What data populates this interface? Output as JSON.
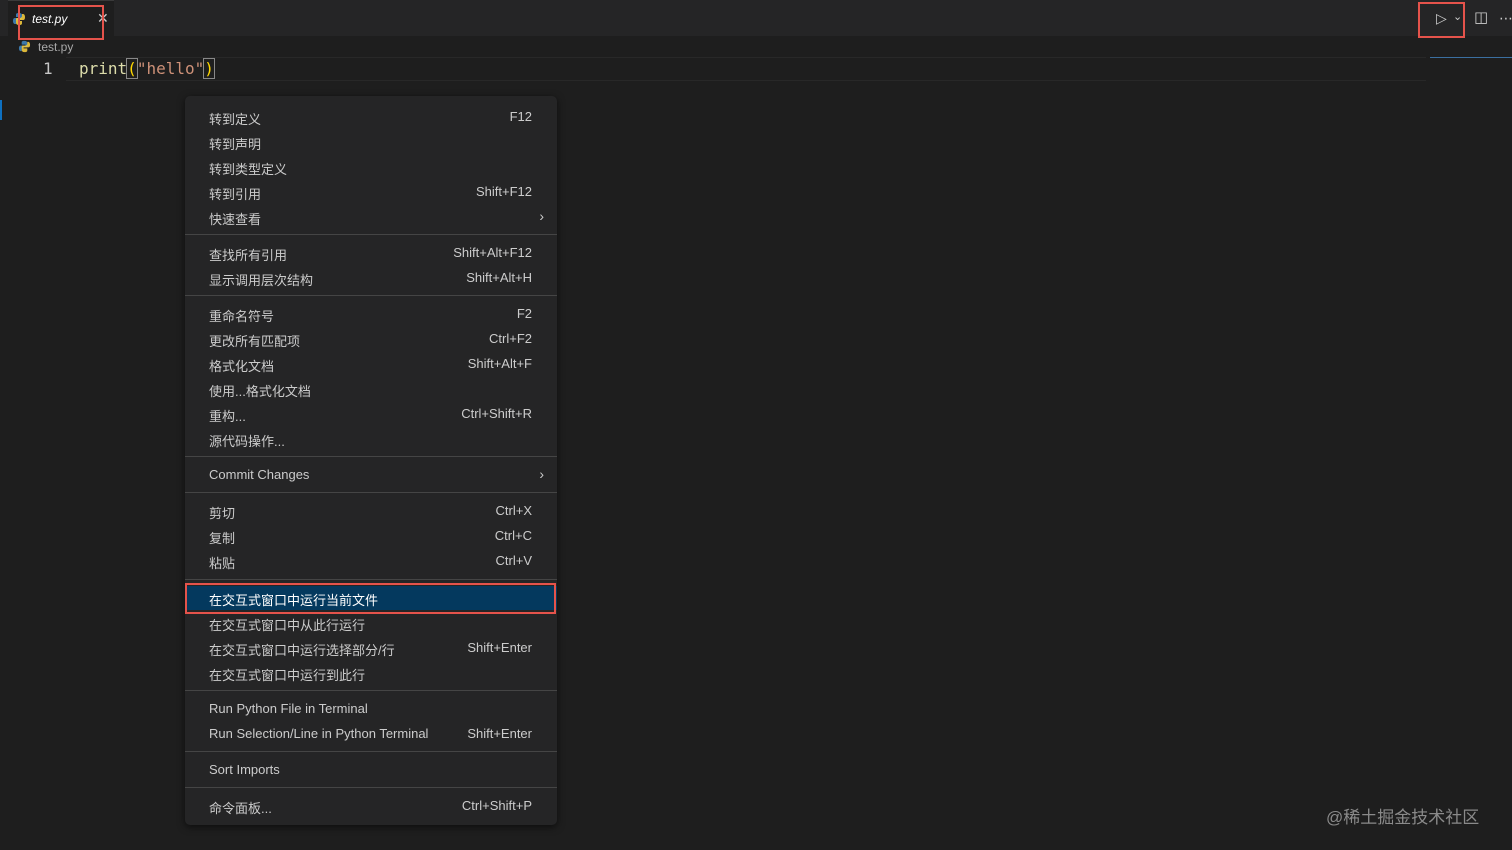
{
  "tab": {
    "filename": "test.py",
    "close_glyph": "✕"
  },
  "toolbar": {
    "run_icon": "▷",
    "run_dropdown_icon": "⌄",
    "split_icon": "◫",
    "more_icon": "⋯"
  },
  "breadcrumb": {
    "file": "test.py"
  },
  "editor": {
    "line_number": "1",
    "code": {
      "fn": "print",
      "open_paren": "(",
      "string": "\"hello\"",
      "close_paren": ")"
    }
  },
  "menu": {
    "items": [
      {
        "label": "转到定义",
        "key": "F12"
      },
      {
        "label": "转到声明",
        "key": ""
      },
      {
        "label": "转到类型定义",
        "key": ""
      },
      {
        "label": "转到引用",
        "key": "Shift+F12"
      },
      {
        "label": "快速查看",
        "key": "",
        "submenu": "›"
      },
      {
        "label": "查找所有引用",
        "key": "Shift+Alt+F12"
      },
      {
        "label": "显示调用层次结构",
        "key": "Shift+Alt+H"
      },
      {
        "label": "重命名符号",
        "key": "F2"
      },
      {
        "label": "更改所有匹配项",
        "key": "Ctrl+F2"
      },
      {
        "label": "格式化文档",
        "key": "Shift+Alt+F"
      },
      {
        "label": "使用...格式化文档",
        "key": ""
      },
      {
        "label": "重构...",
        "key": "Ctrl+Shift+R"
      },
      {
        "label": "源代码操作...",
        "key": ""
      },
      {
        "label": "Commit Changes",
        "key": "",
        "submenu": "›"
      },
      {
        "label": "剪切",
        "key": "Ctrl+X"
      },
      {
        "label": "复制",
        "key": "Ctrl+C"
      },
      {
        "label": "粘贴",
        "key": "Ctrl+V"
      },
      {
        "label": "在交互式窗口中运行当前文件",
        "key": ""
      },
      {
        "label": "在交互式窗口中从此行运行",
        "key": ""
      },
      {
        "label": "在交互式窗口中运行选择部分/行",
        "key": "Shift+Enter"
      },
      {
        "label": "在交互式窗口中运行到此行",
        "key": ""
      },
      {
        "label": "Run Python File in Terminal",
        "key": ""
      },
      {
        "label": "Run Selection/Line in Python Terminal",
        "key": "Shift+Enter"
      },
      {
        "label": "Sort Imports",
        "key": ""
      },
      {
        "label": "命令面板...",
        "key": "Ctrl+Shift+P"
      }
    ]
  },
  "watermark": "@稀土掘金技术社区",
  "colors": {
    "highlight_border": "#e5534b",
    "selected_item": "#04395e",
    "background": "#1e1e1e"
  }
}
